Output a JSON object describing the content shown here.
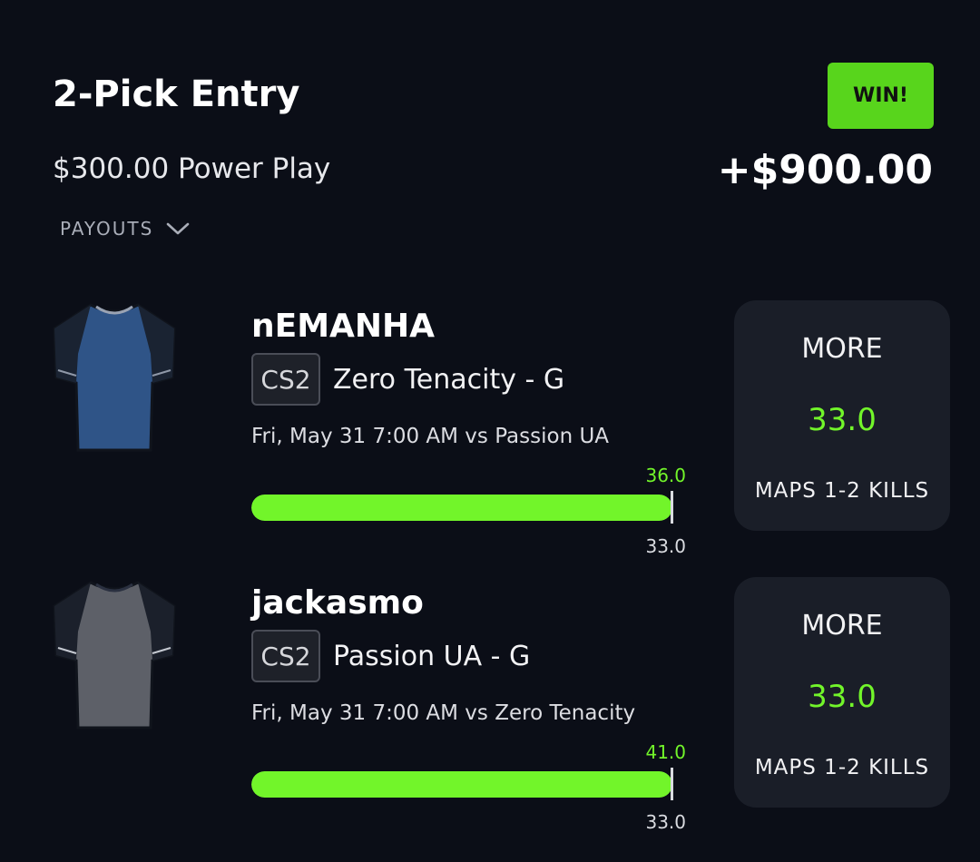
{
  "header": {
    "title": "2-Pick Entry",
    "entry_summary": "$300.00 Power Play",
    "payouts_label": "PAYOUTS",
    "result_badge": "WIN!",
    "payout": "+$900.00"
  },
  "colors": {
    "background": "#0b0e17",
    "accent_green": "#72f52a",
    "win_badge": "#58d51c",
    "card": "#1a1e28"
  },
  "picks": [
    {
      "player": "nEMANHA",
      "league": "CS2",
      "team_position": "Zero Tenacity - G",
      "game": "Fri, May 31 7:00 AM  vs Passion UA",
      "jersey_color": "#2f5487",
      "jersey_icon": "jersey-icon",
      "actual": "36.0",
      "line": "33.0",
      "progress_fraction": 1.0,
      "direction": "MORE",
      "line_display": "33.0",
      "stat": "MAPS 1-2 KILLS"
    },
    {
      "player": "jackasmo",
      "league": "CS2",
      "team_position": "Passion UA - G",
      "game": "Fri, May 31 7:00 AM  vs Zero Tenacity",
      "jersey_color": "#5d6068",
      "jersey_icon": "jersey-icon",
      "actual": "41.0",
      "line": "33.0",
      "progress_fraction": 1.0,
      "direction": "MORE",
      "line_display": "33.0",
      "stat": "MAPS 1-2 KILLS"
    }
  ]
}
